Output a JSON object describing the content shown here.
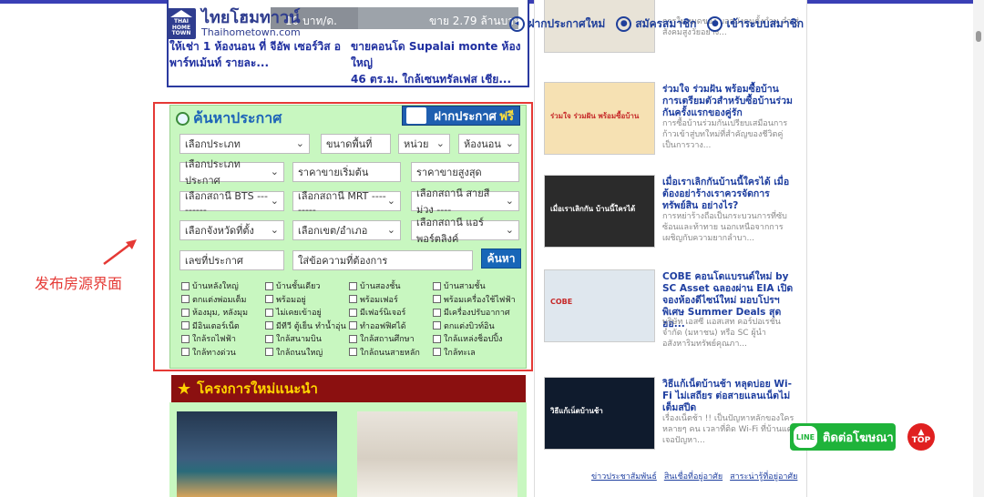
{
  "header": {
    "logo_small": [
      "THAI",
      "HOME",
      "TOWN"
    ],
    "logo_title": "ไทยโฮมทาวน์",
    "logo_url": "Thaihometown.com",
    "nav": [
      {
        "label": "ฝากประกาศใหม่",
        "icon": "megaphone-icon"
      },
      {
        "label": "สมัครสมาชิก",
        "icon": "user-icon"
      },
      {
        "label": "เข้าระบบสมาชิก",
        "icon": "user-icon"
      }
    ]
  },
  "top_listings": [
    {
      "price": "10 บาท/ด.",
      "title_line1": "ให้เช่า 1 ห้องนอน ที่ จีอัพ เซอร์วิส อ",
      "title_line2": "พาร์ทเม้นท์ รายละ..."
    },
    {
      "price": "ขาย 2.79 ล้านบาท",
      "title_line1": "ขายคอนโด Supalai monte ห้องใหญ่",
      "title_line2": "46 ตร.ม. ใกล้เซนทรัลเฟส เชีย..."
    }
  ],
  "search": {
    "title": "ค้นหาประกาศ",
    "free_button": {
      "label": "ฝากประกาศ",
      "highlight": "ฟรี"
    },
    "fields": {
      "type": "เลือกประเภท",
      "area": "ขนาดพื้นที่",
      "unit": "หน่วย",
      "bedroom": "ห้องนอน",
      "listing_type": "เลือกประเภทประกาศ",
      "price_min": "ราคาขายเริ่มต้น",
      "price_max": "ราคาขายสูงสุด",
      "bts": "เลือกสถานี BTS ---------",
      "mrt": "เลือกสถานี MRT ---------",
      "purple": "เลือกสถานี สายสีม่วง ----",
      "province": "เลือกจังหวัดที่ตั้ง",
      "district": "เลือกเขต/อำเภอ",
      "airport": "เลือกสถานี แอร์พอร์ตลิงค์",
      "listing_no": "เลขที่ประกาศ",
      "keyword": "ใส่ข้อความที่ต้องการ",
      "search_btn": "ค้นหา"
    },
    "checkboxes": [
      [
        "บ้านหลังใหญ่",
        "บ้านชั้นเดียว",
        "บ้านสองชั้น",
        "บ้านสามชั้น"
      ],
      [
        "ตกแต่งพ่อมเต็ม",
        "พร้อมอยู่",
        "พร้อมเฟอร์",
        "พร้อมเครื่องใช้ไฟฟ้า"
      ],
      [
        "ห้องมุม, หลังมุม",
        "ไม่เคยเข้าอยู่",
        "มีเฟอร์นิเจอร์",
        "มีเครื่องปรับอากาศ"
      ],
      [
        "มีอินเตอร์เน็ต",
        "มีทีวี ตู้เย็น ทำน้ำอุ่น",
        "ทำออฟฟิศได้",
        "ตกแต่งบิวท์อิน"
      ],
      [
        "ใกล้รถไฟฟ้า",
        "ใกล้สนามบิน",
        "ใกล้สถานศึกษา",
        "ใกล้แหล่งช็อปปิ้ง"
      ],
      [
        "ใกล้ทางด่วน",
        "ใกล้ถนนใหญ่",
        "ใกล้ถนนสายหลัก",
        "ใกล้ทะเล"
      ]
    ]
  },
  "annotation": {
    "label": "发布房源界面"
  },
  "projects": {
    "title": "โครงการใหม่แนะนำ"
  },
  "articles": [
    {
      "title": "",
      "desc": "การในหมดของ บอลบังคมตั้งกำน ลำ  สู่สังคมสูงวัยอย่าง...",
      "img_text": "",
      "img_color": "#e8e3d7"
    },
    {
      "title": "ร่วมใจ ร่วมฝัน พร้อมซื้อบ้าน การเตรียมตัวสำหรับซื้อบ้านร่วมกันครั้งแรกของคู่รัก",
      "desc": "การซื้อบ้านร่วมกันเปรียบเสมือนการก้าวเข้าสู่บทใหม่ที่สำคัญของชีวิตคู่ เป็นการวาง...",
      "img_text": "ร่วมใจ ร่วมฝัน พร้อมซื้อบ้าน",
      "img_color": "#f6e1b3"
    },
    {
      "title": "เมื่อเราเลิกกันบ้านนี้ใครได้ เมื่อต้องอย่าร้างเราควรจัดการทรัพย์สิน อย่างไร?",
      "desc": "การหย่าร้างถือเป็นกระบวนการที่ซับซ้อนและท้าทาย นอกเหนือจากการเผชิญกับความยากลำบา...",
      "img_text": "เมื่อเราเลิกกัน บ้านนี้ใครได้",
      "img_color": "#2b2b2b"
    },
    {
      "title": "COBE คอนโดแบรนด์ใหม่ by SC Asset ฉลองผ่าน EIA เปิดจองห้องดีไซน์ใหม่ มอบโปรฯ พิเศษ Summer Deals สุดฮอ...",
      "desc": "บริษัท เอสซี แอสเสท คอร์ปอเรชั่น จำกัด (มหาชน) หรือ SC ผู้นำอสังหาริมทรัพย์คุณภา...",
      "img_text": "COBE",
      "img_color": "#dfe7ee"
    },
    {
      "title": "วิธีแก้เน็ตบ้านช้า หลุดบ่อย Wi-Fi ไม่เสถียร ต่อสายแลนเน็ตไม่เต็มสปีด",
      "desc": "เรื่องเน็ตช้า !! เป็นปัญหาหลักของใครหลายๆ คน เวลาที่ติด Wi-Fi ที่บ้านแต่เจอปัญหา...",
      "img_text": "วิธีแก้เน็ตบ้านช้า",
      "img_color": "#0f1b2d"
    }
  ],
  "footer_links": [
    "ข่าวประชาสัมพันธ์",
    "สินเชื่อที่อยู่อาศัย",
    "สาระน่ารู้ที่อยู่อาศัย"
  ],
  "line_button": {
    "logo": "LINE",
    "label": "ติดต่อโฆษณา"
  },
  "top_button": {
    "label": "TOP"
  }
}
